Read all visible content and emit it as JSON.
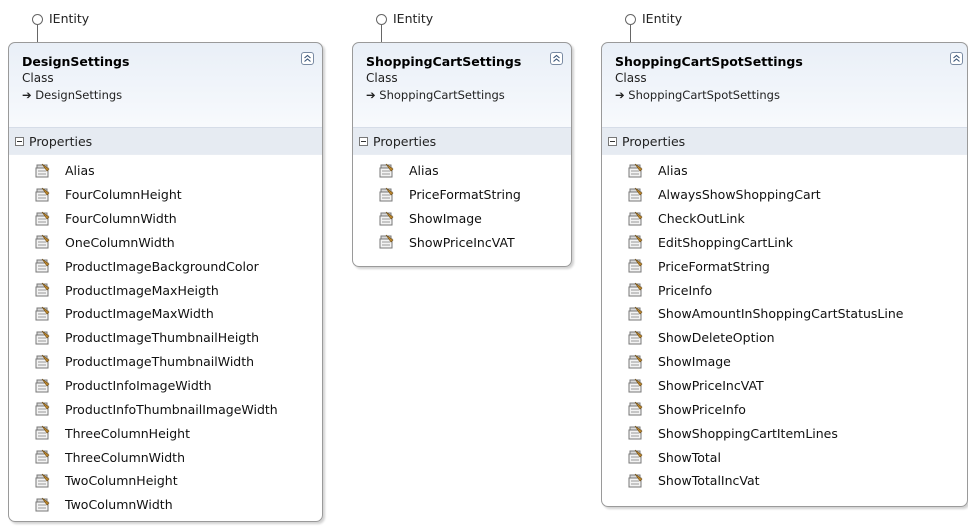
{
  "classes": [
    {
      "interface": "IEntity",
      "name": "DesignSettings",
      "kind": "Class",
      "base": "DesignSettings",
      "section": "Properties",
      "properties": [
        "Alias",
        "FourColumnHeight",
        "FourColumnWidth",
        "OneColumnWidth",
        "ProductImageBackgroundColor",
        "ProductImageMaxHeigth",
        "ProductImageMaxWidth",
        "ProductImageThumbnailHeigth",
        "ProductImageThumbnailWidth",
        "ProductInfoImageWidth",
        "ProductInfoThumbnailImageWidth",
        "ThreeColumnHeight",
        "ThreeColumnWidth",
        "TwoColumnHeight",
        "TwoColumnWidth"
      ]
    },
    {
      "interface": "IEntity",
      "name": "ShoppingCartSettings",
      "kind": "Class",
      "base": "ShoppingCartSettings",
      "section": "Properties",
      "properties": [
        "Alias",
        "PriceFormatString",
        "ShowImage",
        "ShowPriceIncVAT"
      ]
    },
    {
      "interface": "IEntity",
      "name": "ShoppingCartSpotSettings",
      "kind": "Class",
      "base": "ShoppingCartSpotSettings",
      "section": "Properties",
      "properties": [
        "Alias",
        "AlwaysShowShoppingCart",
        "CheckOutLink",
        "EditShoppingCartLink",
        "PriceFormatString",
        "PriceInfo",
        "ShowAmountInShoppingCartStatusLine",
        "ShowDeleteOption",
        "ShowImage",
        "ShowPriceIncVAT",
        "ShowPriceInfo",
        "ShowShoppingCartItemLines",
        "ShowTotal",
        "ShowTotalIncVat"
      ]
    }
  ]
}
